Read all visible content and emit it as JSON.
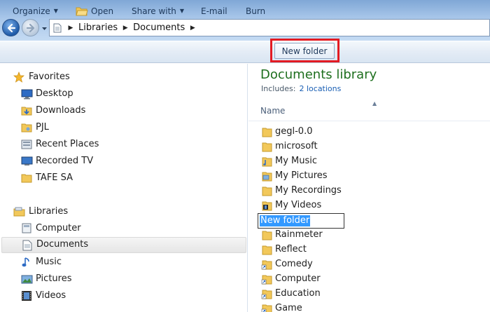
{
  "address": {
    "crumbs": [
      "Libraries",
      "Documents"
    ]
  },
  "toolbar": {
    "organize": "Organize",
    "open": "Open",
    "share_with": "Share with",
    "email": "E-mail",
    "burn": "Burn",
    "new_folder": "New folder"
  },
  "nav": {
    "favorites_header": "Favorites",
    "favorites": [
      "Desktop",
      "Downloads",
      "PJL",
      "Recent Places",
      "Recorded TV",
      "TAFE SA"
    ],
    "libraries_header": "Libraries",
    "libraries": [
      "Computer",
      "Documents",
      "Music",
      "Pictures",
      "Videos"
    ]
  },
  "content": {
    "title": "Documents library",
    "includes_label": "Includes:",
    "includes_link": "2 locations",
    "column_name": "Name",
    "items": [
      "gegl-0.0",
      "microsoft",
      "My Music",
      "My Pictures",
      "My Recordings",
      "My Videos",
      "New folder",
      "Rainmeter",
      "Reflect",
      "Comedy",
      "Computer",
      "Education",
      "Game"
    ],
    "rename_value": "New folder"
  },
  "colors": {
    "library_title": "#1e6f1e",
    "highlight_box": "#e31b23",
    "selection": "#3399ff",
    "folder": "#f2c85a"
  }
}
